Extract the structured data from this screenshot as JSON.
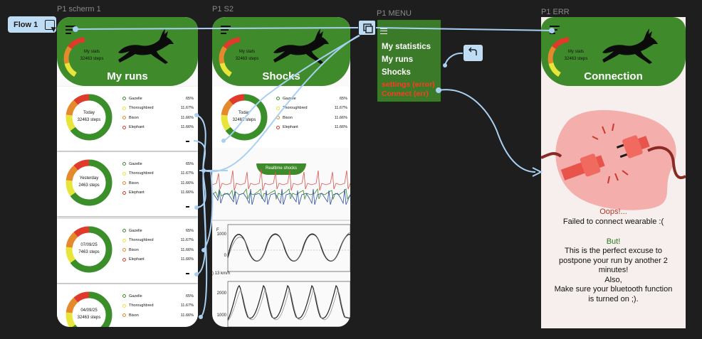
{
  "canvas": {
    "flow_label": "Flow 1",
    "frames": {
      "p1_scherm1": "P1 scherm 1",
      "p1_s2": "P1 S2",
      "p1_menu": "P1 MENU",
      "p1_err": "P1 ERR"
    }
  },
  "header": {
    "gauge_title": "My stats",
    "gauge_steps": "32463 steps"
  },
  "screen_runs": {
    "title": "My runs",
    "cards": [
      {
        "date": "Today",
        "steps": "32463 steps"
      },
      {
        "date": "Yesterday",
        "steps": "2463 steps"
      },
      {
        "date": "07/09/25",
        "steps": "7463 steps"
      },
      {
        "date": "04/09/25",
        "steps": "32463 steps"
      }
    ]
  },
  "legend": [
    {
      "name": "Gazelle",
      "pct": "65%",
      "color": "#3a8f2a"
    },
    {
      "name": "Thoroughbred",
      "pct": "11.67%",
      "color": "#e8e53a"
    },
    {
      "name": "Bison",
      "pct": "11.66%",
      "color": "#e58a2c"
    },
    {
      "name": "Elephant",
      "pct": "11.66%",
      "color": "#e03a2a"
    }
  ],
  "screen_shocks": {
    "title": "Shocks",
    "card": {
      "date": "Today",
      "steps": "32463 steps"
    },
    "realtime_button": "Realtime shocks",
    "plot_axis": {
      "tick_a": "1000",
      "tick_b": "0",
      "tick_c": "2000",
      "tick_d": "1000",
      "speed_label": ") 13 km/h",
      "y_label": "F"
    }
  },
  "menu": {
    "items": [
      {
        "label": "My statistics",
        "warn": false
      },
      {
        "label": "My runs",
        "warn": false
      },
      {
        "label": "Shocks",
        "warn": false
      },
      {
        "label": "settings (error)",
        "warn": true
      },
      {
        "label": "Connect (err)",
        "warn": true
      }
    ]
  },
  "screen_error": {
    "title": "Connection",
    "oops": "Oops!...",
    "line1": "Failed to connect wearable :(",
    "but": "But!",
    "line2": "This is the perfect excuse to",
    "line3": "postpone your run by another 2",
    "line4": "minutes!",
    "line5": "Also,",
    "line6": "Make sure your bluetooth function",
    "line7": "is turned on ;)."
  },
  "colors": {
    "brand_green": "#3f8b2b",
    "prototype_blue": "#bfdcf5",
    "error_red": "#ff3b1f"
  }
}
